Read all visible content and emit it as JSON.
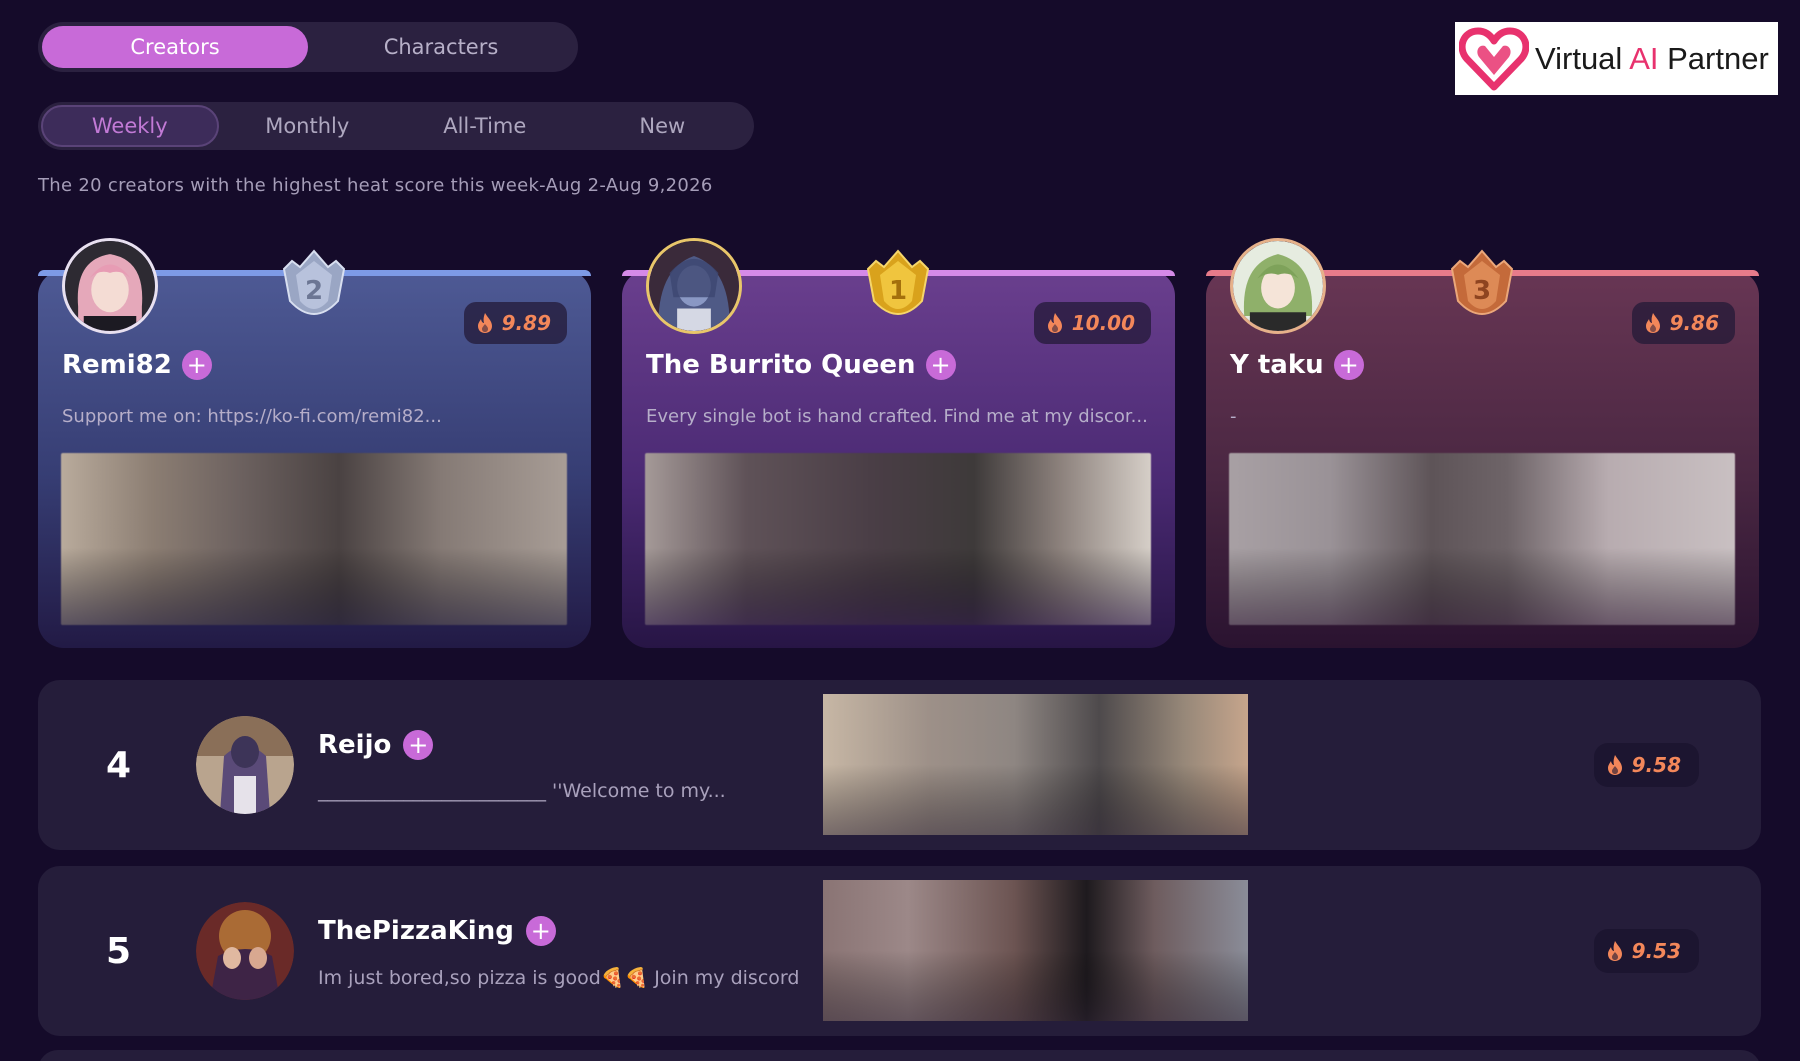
{
  "main_tabs": [
    {
      "label": "Creators",
      "active": true
    },
    {
      "label": "Characters",
      "active": false
    }
  ],
  "period_tabs": [
    {
      "label": "Weekly",
      "active": true
    },
    {
      "label": "Monthly",
      "active": false
    },
    {
      "label": "All-Time",
      "active": false
    },
    {
      "label": "New",
      "active": false
    }
  ],
  "subtitle": "The 20 creators with the highest heat score this week-Aug 2-Aug 9,2026",
  "logo": {
    "word1": "Virtual ",
    "word2": "AI",
    "word3": " Partner",
    "accent": "#e8326e"
  },
  "colors": {
    "accent": "#c86ad8",
    "heat": "#f3875a",
    "background": "#150b2a"
  },
  "podium": [
    {
      "rank": "2",
      "name": "Remi82",
      "heat": "9.89",
      "desc": "Support me on: https://ko-fi.com/remi82...",
      "medal": "silver-medal-icon"
    },
    {
      "rank": "1",
      "name": "The Burrito Queen",
      "heat": "10.00",
      "desc": "Every single bot is hand crafted. Find me at my discor...",
      "medal": "gold-medal-icon"
    },
    {
      "rank": "3",
      "name": "Y taku",
      "heat": "9.86",
      "desc": "-",
      "medal": "bronze-medal-icon"
    }
  ],
  "rows": [
    {
      "rank": "4",
      "name": "Reijo",
      "heat": "9.58",
      "desc": "________________________ ''Welcome to my..."
    },
    {
      "rank": "5",
      "name": "ThePizzaKing",
      "heat": "9.53",
      "desc": "Im just bored,so pizza is good🍕🍕 Join my discord"
    }
  ],
  "icons": {
    "follow": "plus-icon",
    "heat": "flame-icon"
  },
  "plus_glyph": "+"
}
